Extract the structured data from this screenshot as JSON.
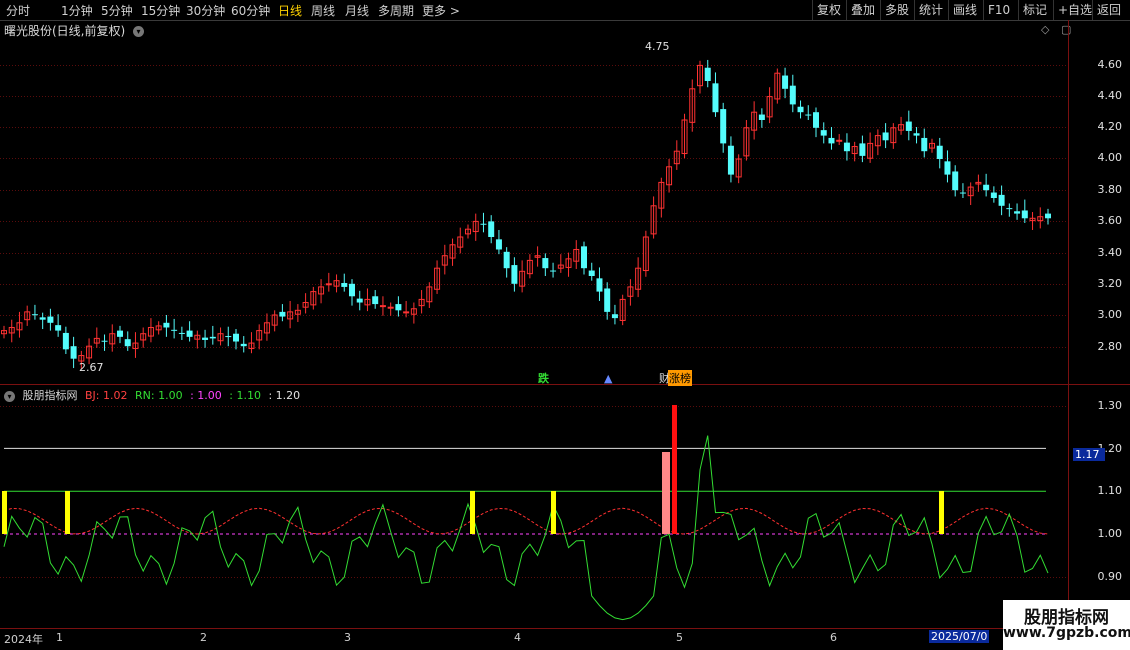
{
  "toolbar": {
    "periods": [
      "分时",
      "1分钟",
      "5分钟",
      "15分钟",
      "30分钟",
      "60分钟",
      "日线",
      "周线",
      "月线",
      "多周期",
      "更多 >"
    ],
    "active_index": 6,
    "right_buttons": [
      "复权",
      "叠加",
      "多股",
      "统计",
      "画线",
      "F10",
      "标记",
      "+自选",
      "返回"
    ]
  },
  "stock": {
    "title": "曙光股份(日线,前复权)"
  },
  "indicator": {
    "name": "股朋指标网",
    "bj_label": "BJ: 1.02",
    "rn_label": "RN: 1.00",
    "v1": ": 1.00",
    "v2": ": 1.10",
    "v3": ": 1.20"
  },
  "price_axis": [
    "4.60",
    "4.40",
    "4.20",
    "4.00",
    "3.80",
    "3.60",
    "3.40",
    "3.20",
    "3.00",
    "2.80"
  ],
  "indicator_axis": [
    "1.30",
    "1.20",
    "1.10",
    "1.00",
    "0.90"
  ],
  "current_value_box": "1.17",
  "annotations": {
    "high": "4.75",
    "low": "2.67"
  },
  "markers": {
    "die": "跌",
    "zhangbang": "涨榜",
    "cai": "财"
  },
  "time_axis": [
    "2024年",
    "1",
    "2",
    "3",
    "4",
    "5",
    "6"
  ],
  "date_box": "2025/07/0",
  "watermark": {
    "line1": "股朋指标网",
    "line2": "www.7gpzb.com"
  },
  "colors": {
    "up": "#ff3232",
    "down": "#54fcfc",
    "green": "#33dd33",
    "yellow": "#ffff00"
  }
}
